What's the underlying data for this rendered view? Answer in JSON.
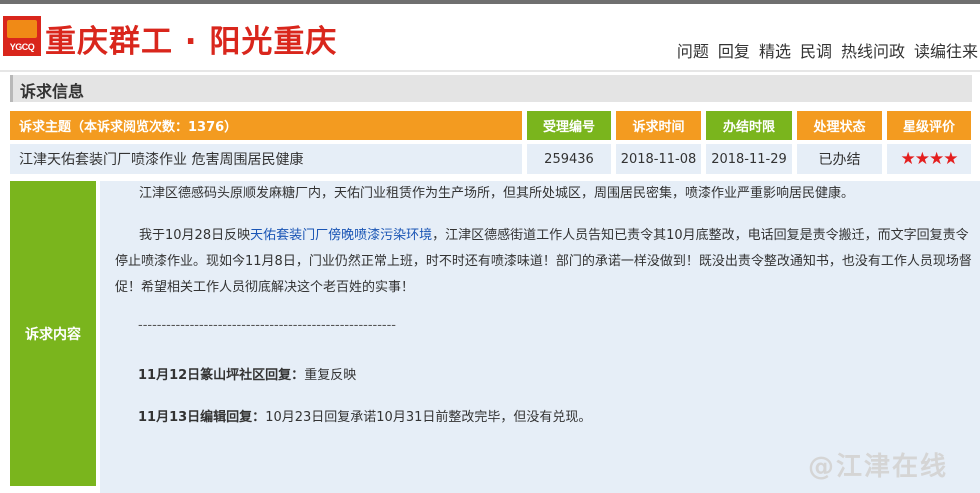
{
  "header": {
    "logo_abbr": "YGCQ",
    "site_title": "重庆群工 · 阳光重庆",
    "nav": [
      "问题",
      "回复",
      "精选",
      "民调",
      "热线问政",
      "读编往来"
    ]
  },
  "section": {
    "title": "诉求信息"
  },
  "table": {
    "headers": {
      "subject": "诉求主题（本诉求阅览次数：1376）",
      "case_no": "受理编号",
      "time": "诉求时间",
      "deadline": "办结时限",
      "status": "处理状态",
      "rating": "星级评价"
    },
    "row": {
      "subject": "江津天佑套装门厂喷漆作业 危害周围居民健康",
      "case_no": "259436",
      "time": "2018-11-08",
      "deadline": "2018-11-29",
      "status": "已办结",
      "rating_stars": "★★★★",
      "rating_value": 4
    }
  },
  "content": {
    "label": "诉求内容",
    "para1": "江津区德感码头原顺发麻糖厂内，天佑门业租赁作为生产场所，但其所处城区，周围居民密集，喷漆作业严重影响居民健康。",
    "para2_pre": "我于10月28日反映",
    "para2_highlight": "天佑套装门厂傍晚喷漆污染环境",
    "para2_post": "，江津区德感街道工作人员告知已责令其10月底整改，电话回复是责令搬迁，而文字回复责令停止喷漆作业。现如今11月8日，门业仍然正常上班，时不时还有喷漆味道！部门的承诺一样没做到！既没出责令整改通知书，也没有工作人员现场督促！希望相关工作人员彻底解决这个老百姓的实事！",
    "divider": "-------------------------------------------------------",
    "reply1_label": "11月12日篆山坪社区回复：",
    "reply1_text": "重复反映",
    "reply2_label": "11月13日编辑回复：",
    "reply2_text": "10月23日回复承诺10月31日前整改完毕，但没有兑现。"
  },
  "watermark": "@江津在线",
  "colors": {
    "brand_red": "#d9261c",
    "header_orange": "#f39b20",
    "header_green": "#7ab51d",
    "row_bg": "#e6eef7",
    "star_red": "#e41f1f",
    "link_blue": "#1a55b5"
  }
}
